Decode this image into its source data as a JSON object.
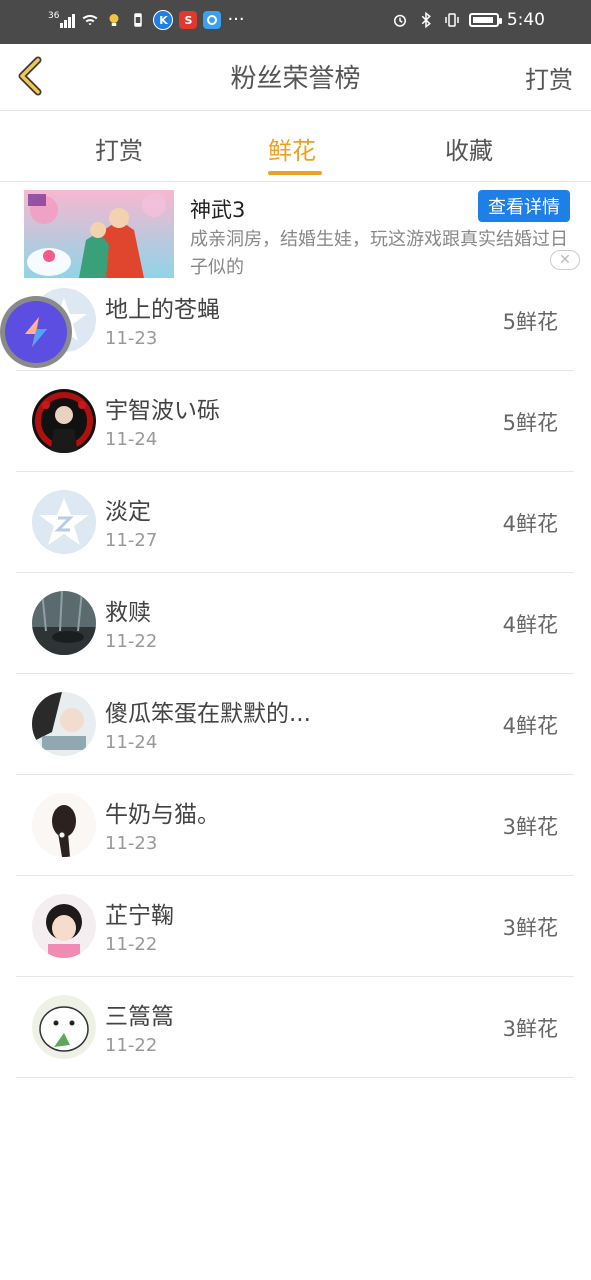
{
  "status_bar": {
    "signal_text": "36",
    "time": "5:40",
    "dots": "···",
    "app_icons": [
      {
        "name": "wifi-icon"
      },
      {
        "name": "bulb-icon",
        "color": "#f5c542"
      },
      {
        "name": "sim-icon"
      },
      {
        "name": "k-app-icon",
        "label": "K",
        "color": "#1e7fe6"
      },
      {
        "name": "s-app-icon",
        "label": "S",
        "color": "#e03a2e"
      },
      {
        "name": "cloud-app-icon",
        "color": "#3aa0f0"
      }
    ]
  },
  "nav": {
    "title": "粉丝荣誉榜",
    "right_label": "打赏",
    "back_icon": "chevron-left-icon",
    "accent_color": "#f0a020"
  },
  "tabs": [
    {
      "label": "打赏",
      "active": false
    },
    {
      "label": "鲜花",
      "active": true
    },
    {
      "label": "收藏",
      "active": false
    }
  ],
  "ad": {
    "title": "神武3",
    "button_label": "查看详情",
    "description": "成亲洞房，结婚生娃，玩这游戏跟真实结婚过日子似的",
    "close_label": "✕"
  },
  "fans": [
    {
      "name": "地上的苍蝇",
      "date": "11-23",
      "amount": "5鲜花"
    },
    {
      "name": "宇智波い砾",
      "date": "11-24",
      "amount": "5鲜花"
    },
    {
      "name": "淡定",
      "date": "11-27",
      "amount": "4鲜花"
    },
    {
      "name": "救赎",
      "date": "11-22",
      "amount": "4鲜花"
    },
    {
      "name": "傻瓜笨蛋在默默的...",
      "date": "11-24",
      "amount": "4鲜花"
    },
    {
      "name": "牛奶与猫。",
      "date": "11-23",
      "amount": "3鲜花"
    },
    {
      "name": "芷宁鞠",
      "date": "11-22",
      "amount": "3鲜花"
    },
    {
      "name": "三篙篙",
      "date": "11-22",
      "amount": "3鲜花"
    }
  ]
}
